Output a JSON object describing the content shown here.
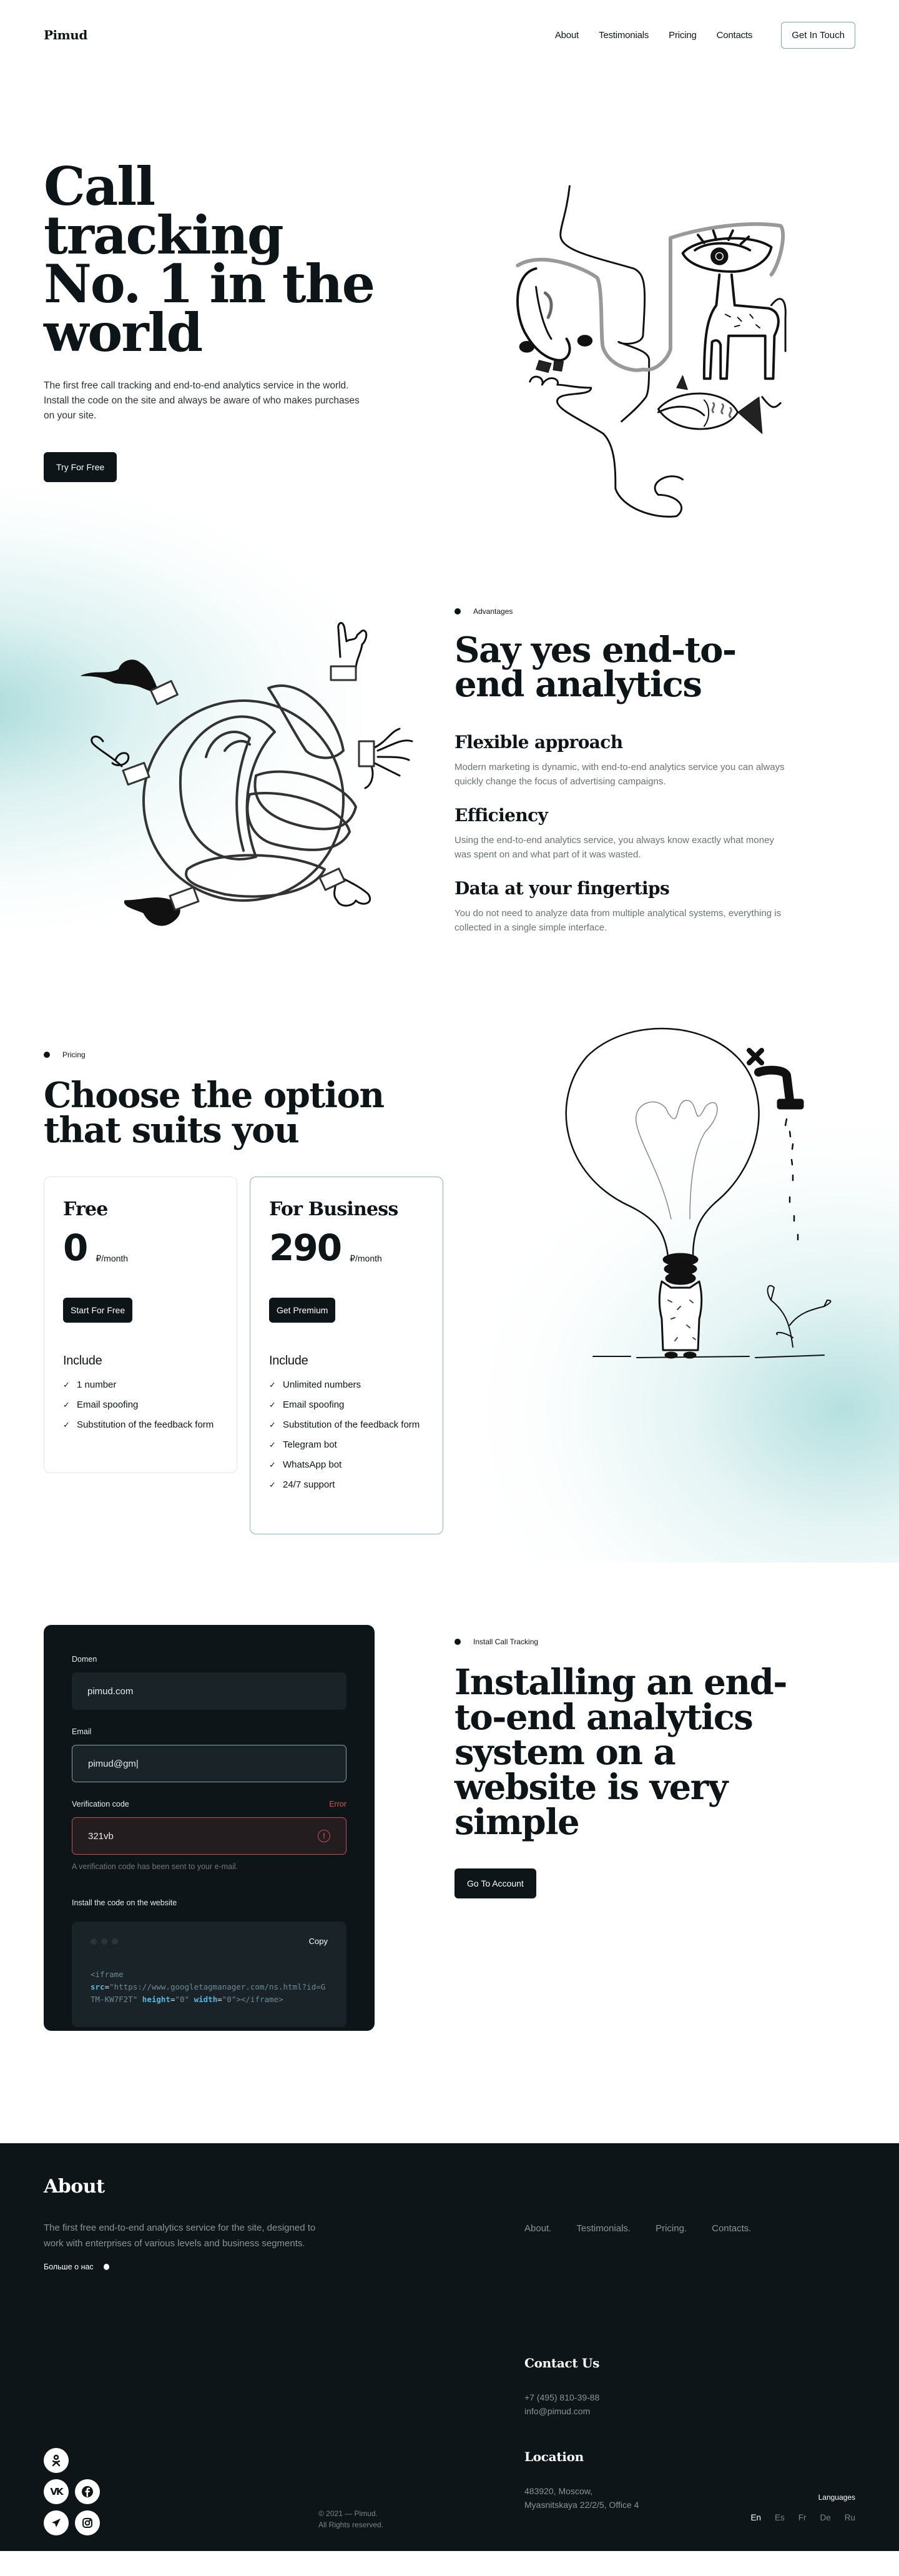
{
  "header": {
    "logo": "Pimud",
    "nav": [
      "About",
      "Testimonials",
      "Pricing",
      "Contacts"
    ],
    "cta": "Get In Touch"
  },
  "hero": {
    "title_lines": [
      "Call tracking",
      "No. 1 in the",
      "world"
    ],
    "description": "The first free call tracking and end-to-end analytics service in the world. Install the code on the site and always be aware of who makes purchases on your site.",
    "cta": "Try For Free"
  },
  "advantages": {
    "tag": "Advantages",
    "title_lines": [
      "Say yes end-to-",
      "end analytics"
    ],
    "features": [
      {
        "title": "Flexible approach",
        "text": "Modern marketing is dynamic, with end-to-end analytics service you can always quickly change the focus of advertising campaigns."
      },
      {
        "title": "Efficiency",
        "text": "Using the end-to-end analytics service, you always know exactly what money was spent on and what part of it was wasted."
      },
      {
        "title": "Data at your fingertips",
        "text": "You do not need to analyze data from multiple analytical systems, everything is collected in a single simple interface."
      }
    ]
  },
  "pricing": {
    "tag": "Pricing",
    "title_lines": [
      "Choose the option",
      "that suits you"
    ],
    "plans": [
      {
        "name": "Free",
        "price": "0",
        "period": "₽/month",
        "cta": "Start For Free",
        "include_label": "Include",
        "features": [
          "1 number",
          "Email spoofing",
          "Substitution of the feedback form"
        ]
      },
      {
        "name": "For Business",
        "price": "290",
        "period": "₽/month",
        "cta": "Get Premium",
        "include_label": "Include",
        "features": [
          "Unlimited numbers",
          "Email spoofing",
          "Substitution of the feedback form",
          "Telegram bot",
          "WhatsApp bot",
          "24/7 support"
        ]
      }
    ]
  },
  "install": {
    "form": {
      "domain_label": "Domen",
      "domain_value": "pimud.com",
      "email_label": "Email",
      "email_value": "pimud@gm|",
      "code_label": "Verification code",
      "code_error": "Error",
      "code_value": "321vb",
      "code_help": "A verification code has been sent to your e-mail.",
      "install_label": "Install the code on the website",
      "copy_label": "Copy",
      "code_snippet": {
        "open": "<iframe",
        "src_attr": "src",
        "src_value": "\"https://www.googletagmanager.com/ns.html?id=GTM-KW7F2T\"",
        "height_attr": "height",
        "height_value": "\"0\"",
        "width_attr": "width",
        "width_value": "\"0\"",
        "close": "></iframe>"
      }
    },
    "tag": "Install Call Tracking",
    "title_lines": [
      "Installing an end-",
      "to-end analytics",
      "system on a",
      "website is very",
      "simple"
    ],
    "cta": "Go To Account"
  },
  "footer": {
    "about_title": "About",
    "about_text": "The first free end-to-end analytics service for the site, designed to work with enterprises of various levels and business segments.",
    "more_link": "Больше о нас",
    "nav": [
      "About.",
      "Testimonials.",
      "Pricing.",
      "Contacts."
    ],
    "contact_title": "Contact Us",
    "phone": "+7 (495) 810-39-88",
    "email": "info@pimud.com",
    "location_title": "Location",
    "address_lines": [
      "483920, Moscow,",
      "Myasnitskaya 22/2/5, Office 4"
    ],
    "copyright_lines": [
      "© 2021 — Pimud.",
      "All Rights reserved."
    ],
    "languages_label": "Languages",
    "languages": [
      "En",
      "Es",
      "Fr",
      "De",
      "Ru"
    ],
    "active_language": "En",
    "socials": [
      "odnoklassniki",
      "vk",
      "facebook",
      "telegram",
      "instagram"
    ]
  },
  "colors": {
    "ink": "#0e1518",
    "accent_teal": "#7aa6a8",
    "error": "#c45050",
    "muted": "#6a7275"
  }
}
